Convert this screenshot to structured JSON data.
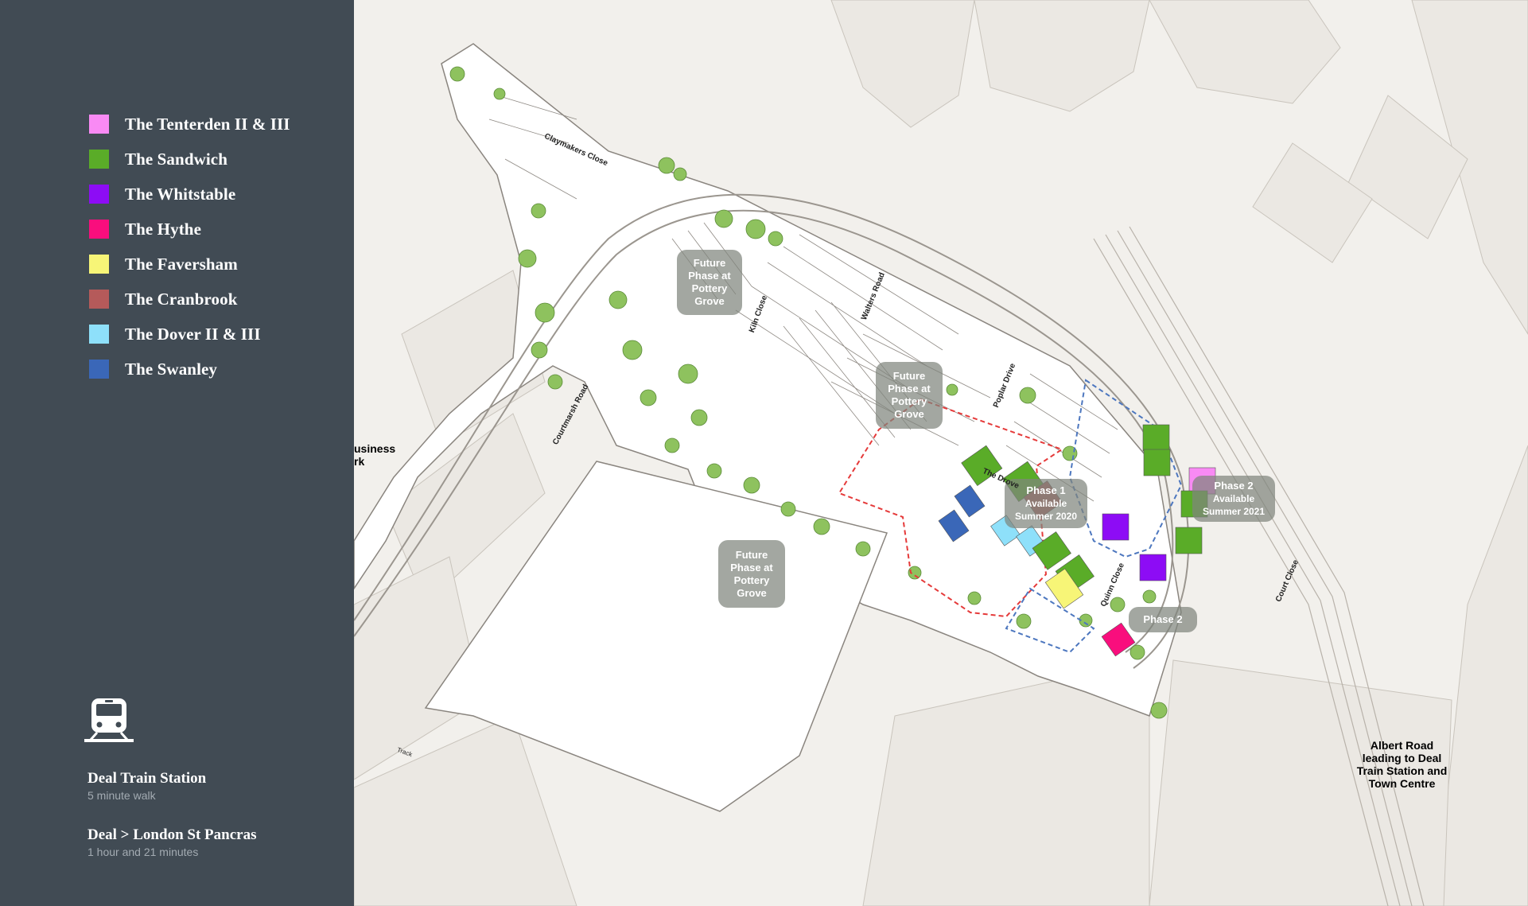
{
  "legend": {
    "items": [
      {
        "label": "The Tenterden II & III",
        "color": "#f98af4"
      },
      {
        "label": "The Sandwich",
        "color": "#5aac28"
      },
      {
        "label": "The Whitstable",
        "color": "#8d0cf5"
      },
      {
        "label": "The Hythe",
        "color": "#f90e7d"
      },
      {
        "label": "The Faversham",
        "color": "#f7f577"
      },
      {
        "label": "The Cranbrook",
        "color": "#b55a5a"
      },
      {
        "label": "The Dover II & III",
        "color": "#8ee0fa"
      },
      {
        "label": "The Swanley",
        "color": "#3a67b8"
      }
    ]
  },
  "transport": {
    "icon": "train-icon",
    "station": {
      "title": "Deal Train Station",
      "subtitle": "5 minute walk"
    },
    "route": {
      "title": "Deal > London St Pancras",
      "subtitle": "1 hour and 21 minutes"
    }
  },
  "map": {
    "phase_labels": {
      "future_1": [
        "Future",
        "Phase at",
        "Pottery",
        "Grove"
      ],
      "future_2": [
        "Future",
        "Phase at",
        "Pottery",
        "Grove"
      ],
      "future_3": [
        "Future",
        "Phase at",
        "Pottery",
        "Grove"
      ],
      "phase1": [
        "Phase 1",
        "Available",
        "Summer 2020"
      ],
      "phase2_available": [
        "Phase 2",
        "Available",
        "Summer 2021"
      ],
      "phase2": "Phase 2"
    },
    "place_labels": {
      "business_park": [
        "usiness",
        "rk"
      ],
      "albert_road": [
        "Albert Road",
        "leading to Deal",
        "Train Station and",
        "Town Centre"
      ]
    },
    "road_names": {
      "claymakers": "Claymakers Close",
      "courtmarsh": "Courtmarsh Road",
      "kiln": "Kiln Close",
      "walters": "Walters Road",
      "poplar": "Poplar Drive",
      "the_drove": "The Drove",
      "quinn": "Quinn Close",
      "court": "Court Close",
      "track": "Track"
    }
  }
}
